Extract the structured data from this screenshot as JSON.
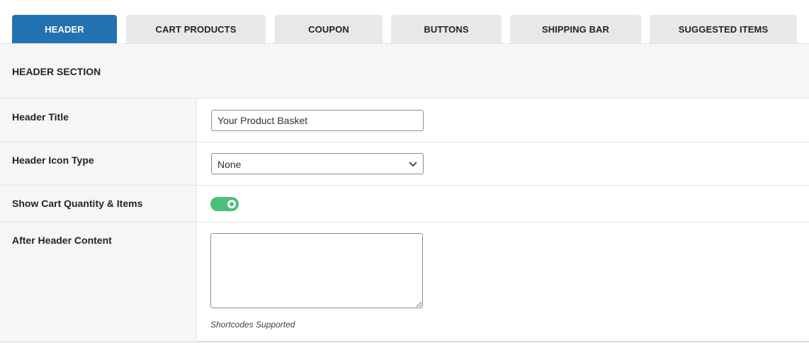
{
  "tabs": [
    {
      "label": "HEADER",
      "active": true
    },
    {
      "label": "CART PRODUCTS",
      "active": false
    },
    {
      "label": "COUPON",
      "active": false
    },
    {
      "label": "BUTTONS",
      "active": false
    },
    {
      "label": "SHIPPING BAR",
      "active": false
    },
    {
      "label": "SUGGESTED ITEMS",
      "active": false
    }
  ],
  "section": {
    "title": "HEADER SECTION"
  },
  "fields": {
    "header_title": {
      "label": "Header Title",
      "value": "Your Product Basket"
    },
    "header_icon_type": {
      "label": "Header Icon Type",
      "value": "None",
      "icon": "chevron-down-icon"
    },
    "show_cart_quantity": {
      "label": "Show Cart Quantity & Items",
      "enabled": true
    },
    "after_header_content": {
      "label": "After Header Content",
      "value": "",
      "hint": "Shortcodes Supported"
    }
  },
  "colors": {
    "accent": "#2271b1",
    "toggle_on": "#4cbf7a",
    "tab_inactive": "#e8e8e8"
  }
}
